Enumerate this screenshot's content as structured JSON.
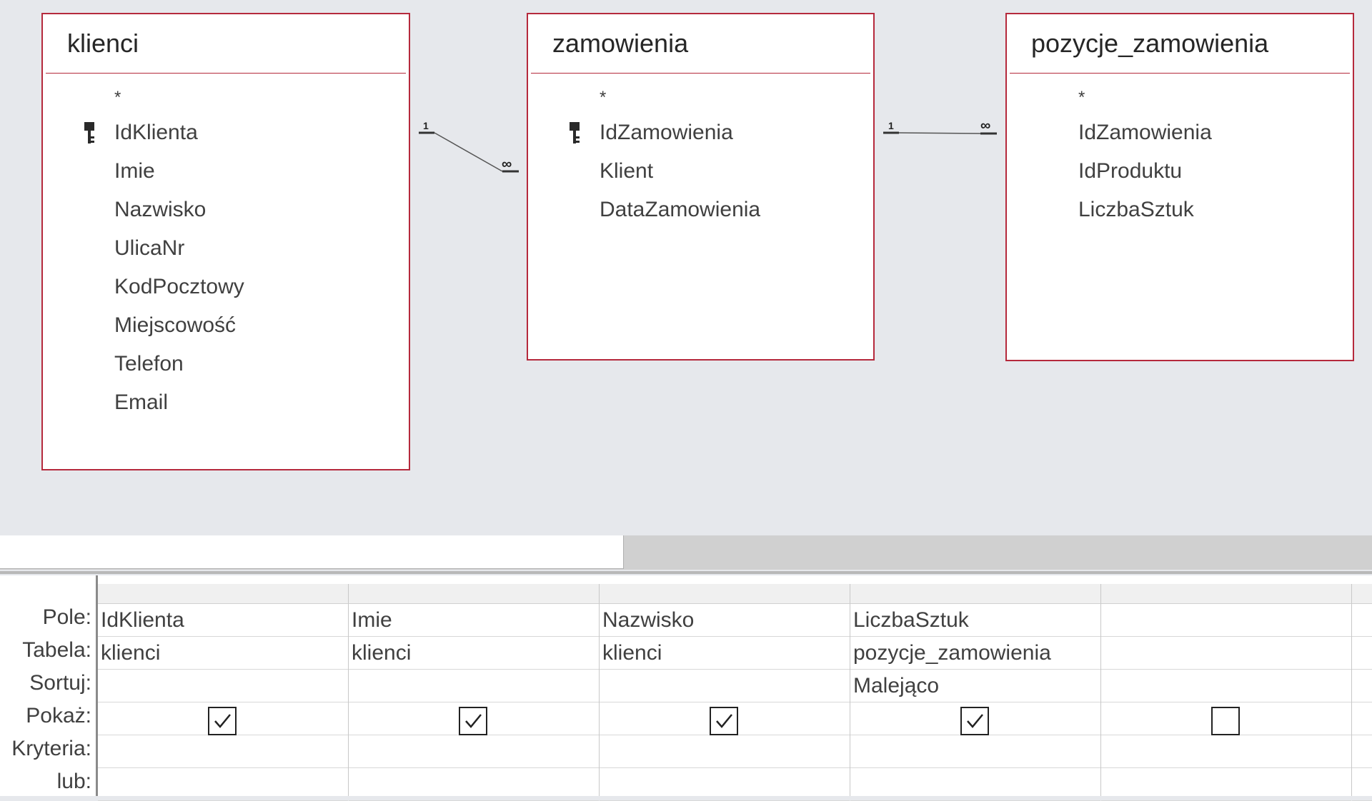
{
  "tables": [
    {
      "name": "klienci",
      "star": "*",
      "fields": [
        {
          "name": "IdKlienta",
          "key": true
        },
        {
          "name": "Imie",
          "key": false
        },
        {
          "name": "Nazwisko",
          "key": false
        },
        {
          "name": "UlicaNr",
          "key": false
        },
        {
          "name": "KodPocztowy",
          "key": false
        },
        {
          "name": "Miejscowość",
          "key": false
        },
        {
          "name": "Telefon",
          "key": false
        },
        {
          "name": "Email",
          "key": false
        }
      ]
    },
    {
      "name": "zamowienia",
      "star": "*",
      "fields": [
        {
          "name": "IdZamowienia",
          "key": true
        },
        {
          "name": "Klient",
          "key": false
        },
        {
          "name": "DataZamowienia",
          "key": false
        }
      ]
    },
    {
      "name": "pozycje_zamowienia",
      "star": "*",
      "fields": [
        {
          "name": "IdZamowienia",
          "key": false
        },
        {
          "name": "IdProduktu",
          "key": false
        },
        {
          "name": "LiczbaSztuk",
          "key": false
        }
      ]
    }
  ],
  "relationships": [
    {
      "one_label": "1",
      "many_label": "∞"
    },
    {
      "one_label": "1",
      "many_label": "∞"
    }
  ],
  "grid": {
    "row_labels": [
      "Pole:",
      "Tabela:",
      "Sortuj:",
      "Pokaż:",
      "Kryteria:",
      "lub:"
    ],
    "columns": [
      {
        "pole": "IdKlienta",
        "tabela": "klienci",
        "sortuj": "",
        "pokaz": true
      },
      {
        "pole": "Imie",
        "tabela": "klienci",
        "sortuj": "",
        "pokaz": true
      },
      {
        "pole": "Nazwisko",
        "tabela": "klienci",
        "sortuj": "",
        "pokaz": true
      },
      {
        "pole": "LiczbaSztuk",
        "tabela": "pozycje_zamowienia",
        "sortuj": "Malejąco",
        "pokaz": true
      },
      {
        "pole": "",
        "tabela": "",
        "sortuj": "",
        "pokaz": false
      }
    ]
  },
  "colors": {
    "table_border": "#b5293c",
    "background": "#e6e8ec"
  },
  "icons": {
    "primary_key": "key-icon",
    "checkbox": "checkmark-icon"
  }
}
